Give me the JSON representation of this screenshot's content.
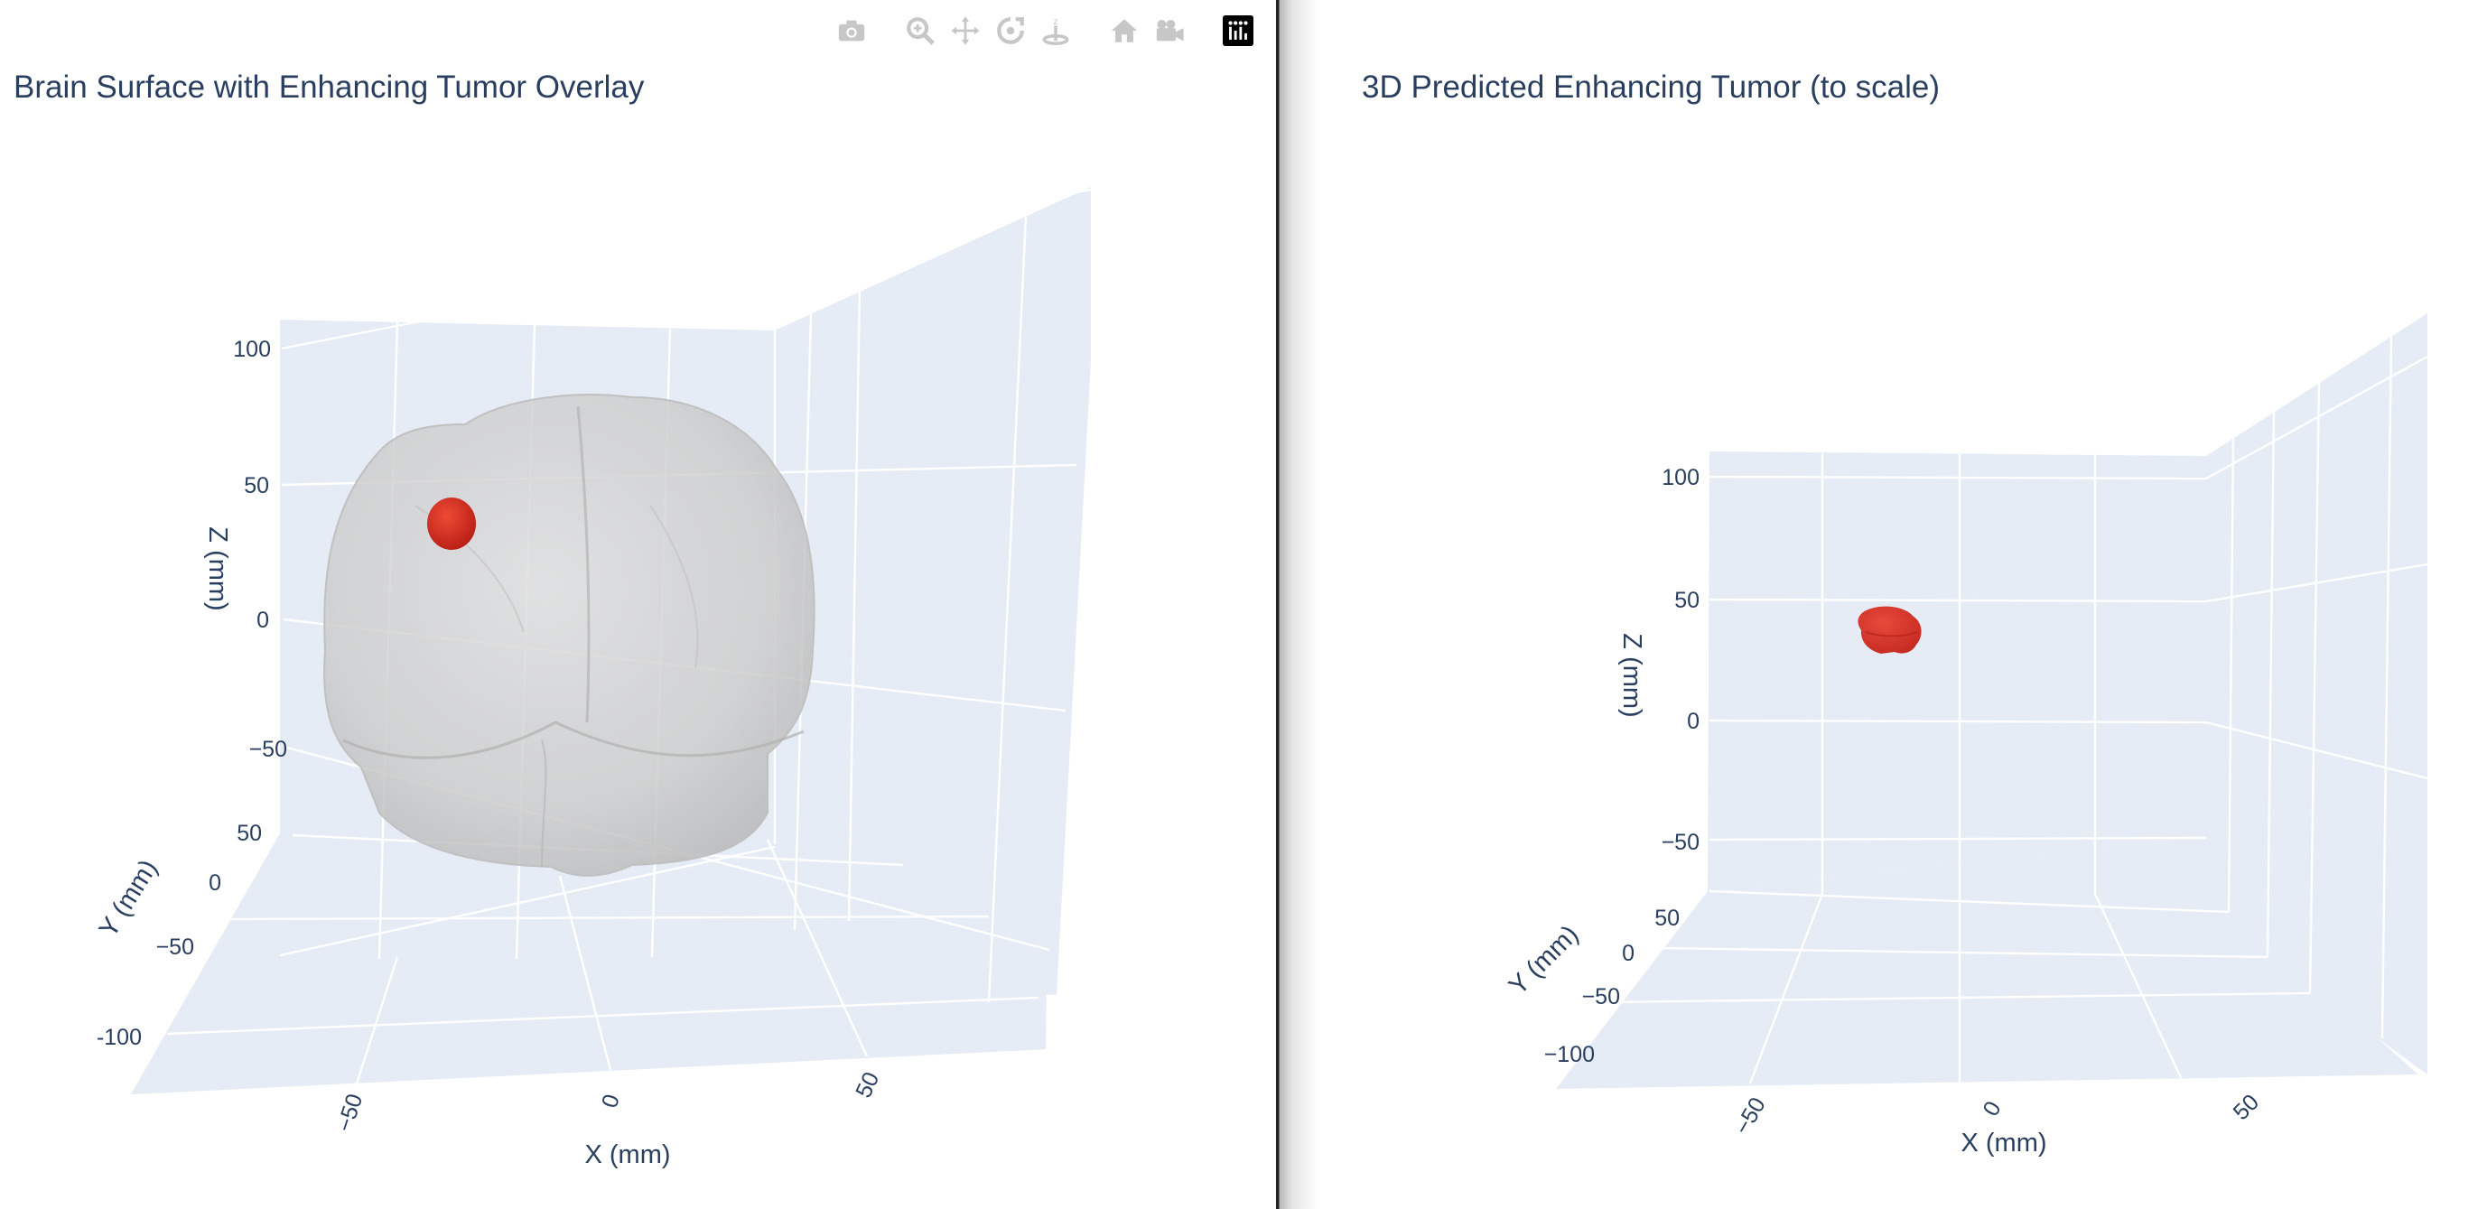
{
  "chart_data": [
    {
      "type": "3d-mesh",
      "title": "Brain Surface with Enhancing Tumor Overlay",
      "xlabel": "X (mm)",
      "ylabel": "Y (mm)",
      "zlabel": "Z (mm)",
      "xticks": [
        "−50",
        "0",
        "50"
      ],
      "yticks": [
        "50",
        "0",
        "−50",
        "-100"
      ],
      "zticks": [
        "100",
        "50",
        "0",
        "−50"
      ],
      "grid": true,
      "meshes": [
        {
          "name": "brain",
          "color": "#cfcfcf",
          "opacity": 0.55
        },
        {
          "name": "tumor",
          "color": "#d42a1e",
          "opacity": 1.0
        }
      ]
    },
    {
      "type": "3d-mesh",
      "title": "3D Predicted Enhancing Tumor (to scale)",
      "xlabel": "X (mm)",
      "ylabel": "Y (mm)",
      "zlabel": "Z (mm)",
      "xticks": [
        "−50",
        "0",
        "50"
      ],
      "yticks": [
        "50",
        "0",
        "−50",
        "−100"
      ],
      "zticks": [
        "100",
        "50",
        "0",
        "−50"
      ],
      "grid": true,
      "meshes": [
        {
          "name": "tumor",
          "color": "#d42a1e",
          "opacity": 0.85
        }
      ]
    }
  ],
  "modebar": {
    "buttons": [
      {
        "icon": "camera-icon"
      },
      {
        "icon": "zoom-icon"
      },
      {
        "icon": "pan-icon"
      },
      {
        "icon": "orbit-rotation-icon"
      },
      {
        "icon": "turntable-rotation-icon"
      },
      {
        "icon": "home-icon"
      },
      {
        "icon": "camera-view-icon"
      },
      {
        "icon": "plotly-logo-icon"
      }
    ]
  },
  "colors": {
    "scene_background": "#e5ecf6",
    "grid": "#ffffff",
    "text": "#2a3f5f",
    "tumor": "#d42a1e",
    "brain": "#cfcfcf"
  }
}
